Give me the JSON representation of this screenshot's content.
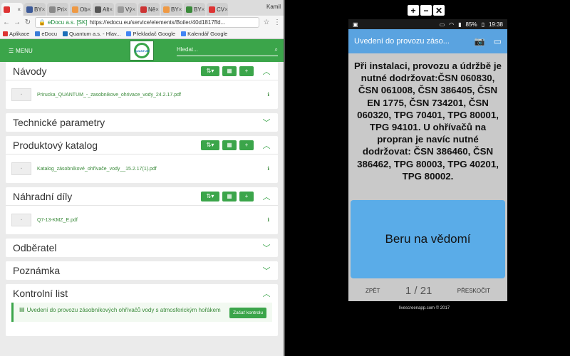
{
  "browser": {
    "tabs": [
      {
        "label": "",
        "color": "#d33"
      },
      {
        "label": "BY",
        "color": "#3b5998"
      },
      {
        "label": "Pri",
        "color": "#888"
      },
      {
        "label": "Ob",
        "color": "#e94"
      },
      {
        "label": "Alt",
        "color": "#555"
      },
      {
        "label": "Vý",
        "color": "#999"
      },
      {
        "label": "Ně",
        "color": "#c33"
      },
      {
        "label": "BY",
        "color": "#e94"
      },
      {
        "label": "BY",
        "color": "#3a8a3a"
      },
      {
        "label": "CV",
        "color": "#d33"
      }
    ],
    "profile": "Kamil",
    "url_secure": "eDocu a.s. [SK]",
    "url": "https://edocu.eu/service/elements/Boiler/40d1817ffd...",
    "bookmarks": [
      "Aplikace",
      "eDocu",
      "Quantum a.s. - Hlav...",
      "Překladač Google",
      "Kalendář Google"
    ]
  },
  "site": {
    "menu_label": "MENU",
    "logo_text": "QUANTUM",
    "search_placeholder": "Hledat..."
  },
  "sections": {
    "navody": {
      "title": "Návody",
      "file": "Prirucka_QUANTUM_-_zasobnikove_ohrivace_vody_24.2.17.pdf"
    },
    "technicke": {
      "title": "Technické parametry"
    },
    "katalog": {
      "title": "Produktový katalog",
      "file": "Katalog_zásobníkové_ohřívače_vody__15.2.17(1).pdf"
    },
    "nahradni": {
      "title": "Náhradní díly",
      "file": "Q7-13-KMZ_E.pdf"
    },
    "odberatel": {
      "title": "Odběratel"
    },
    "poznamka": {
      "title": "Poznámka"
    },
    "kontrolni": {
      "title": "Kontrolní list",
      "item": "Uvedení do provozu zásobníkových ohřívačů vody s atmosferickým hořákem",
      "button": "Začať kontrolu"
    }
  },
  "phone": {
    "status_battery": "85%",
    "status_time": "19:38",
    "app_title": "Uvedení do provozu záso...",
    "message": "Při instalaci, provozu a údržbě je nutné dodržovat:ČSN 060830, ČSN 061008, ČSN 386405, ČSN EN 1775, ČSN 734201, ČSN 060320, TPG 70401, TPG 80001, TPG 94101. U ohřívačů na propran je navíc nutné dodržovat: ČSN 386460, ČSN 386462, TPG 80003, TPG 40201, TPG 80002.",
    "ack_button": "Beru na vědomí",
    "back": "ZPĚT",
    "page": "1 / 21",
    "skip": "PŘESKOČIT"
  },
  "footer": "livescreenapp.com © 2017",
  "colors": {
    "green": "#3ba54a",
    "blue": "#5aa3e0"
  }
}
